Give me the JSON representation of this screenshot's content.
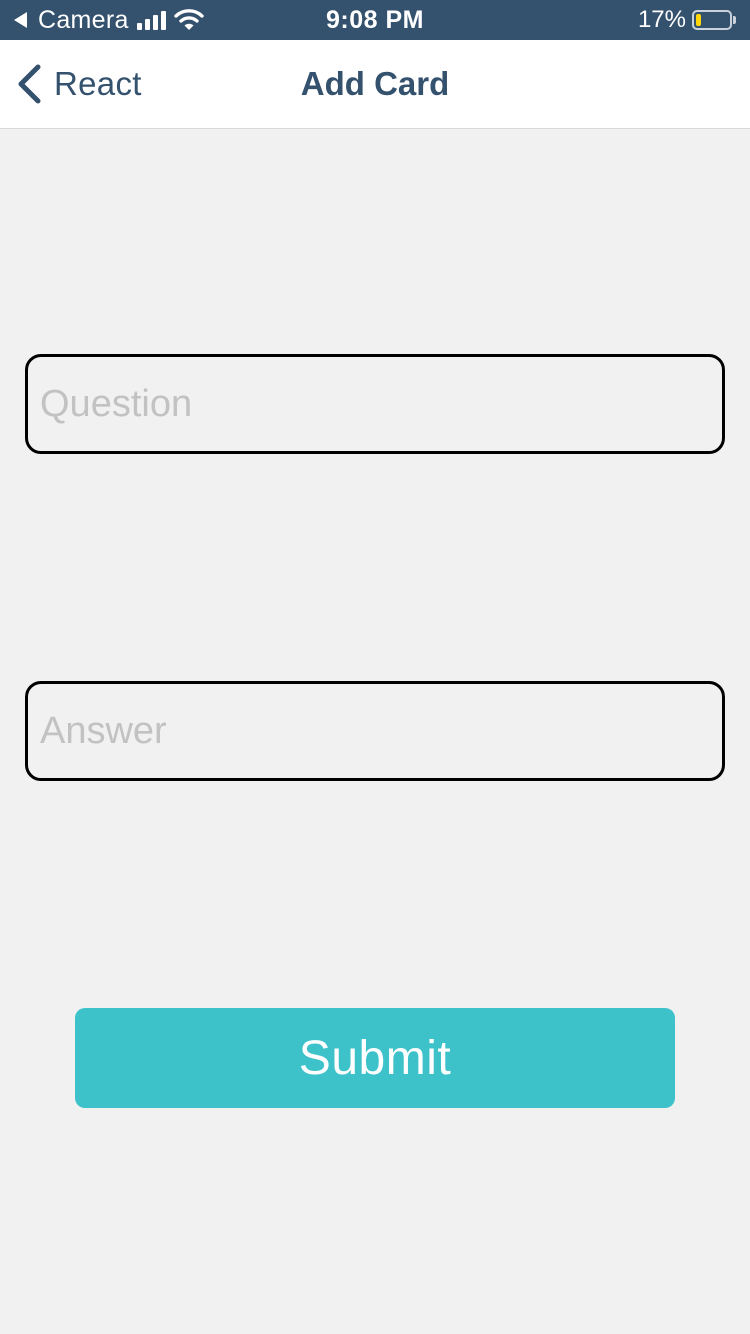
{
  "status_bar": {
    "back_app_label": "Camera",
    "time": "9:08 PM",
    "battery_percent": "17%",
    "battery_level": 0.17,
    "signal_bars": 4,
    "icons": [
      "back-triangle-icon",
      "signal-bars-icon",
      "wifi-icon",
      "battery-icon"
    ],
    "background_color": "#34516e"
  },
  "nav": {
    "back_label": "React",
    "title": "Add Card",
    "back_icon": "chevron-left-icon",
    "color": "#34516e"
  },
  "form": {
    "question": {
      "placeholder": "Question",
      "value": ""
    },
    "answer": {
      "placeholder": "Answer",
      "value": ""
    },
    "submit_label": "Submit",
    "submit_color": "#3ec2ca"
  }
}
